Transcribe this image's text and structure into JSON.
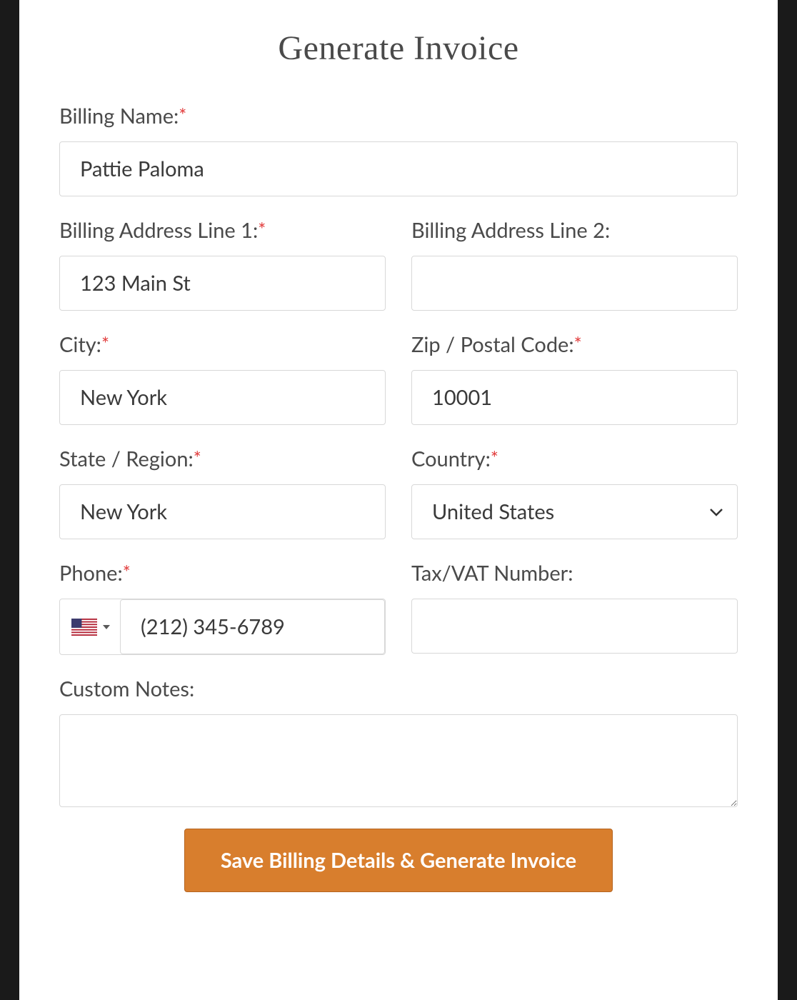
{
  "title": "Generate Invoice",
  "labels": {
    "billing_name": "Billing Name:",
    "address1": "Billing Address Line 1:",
    "address2": "Billing Address Line 2:",
    "city": "City:",
    "zip": "Zip / Postal Code:",
    "state": "State / Region:",
    "country": "Country:",
    "phone": "Phone:",
    "tax": "Tax/VAT Number:",
    "notes": "Custom Notes:"
  },
  "required_mark": "*",
  "values": {
    "billing_name": "Pattie Paloma",
    "address1": "123 Main St",
    "address2": "",
    "city": "New York",
    "zip": "10001",
    "state": "New York",
    "country": "United States",
    "phone": "(212) 345-6789",
    "tax": "",
    "notes": ""
  },
  "submit_label": "Save Billing Details & Generate Invoice",
  "flag_country": "us"
}
